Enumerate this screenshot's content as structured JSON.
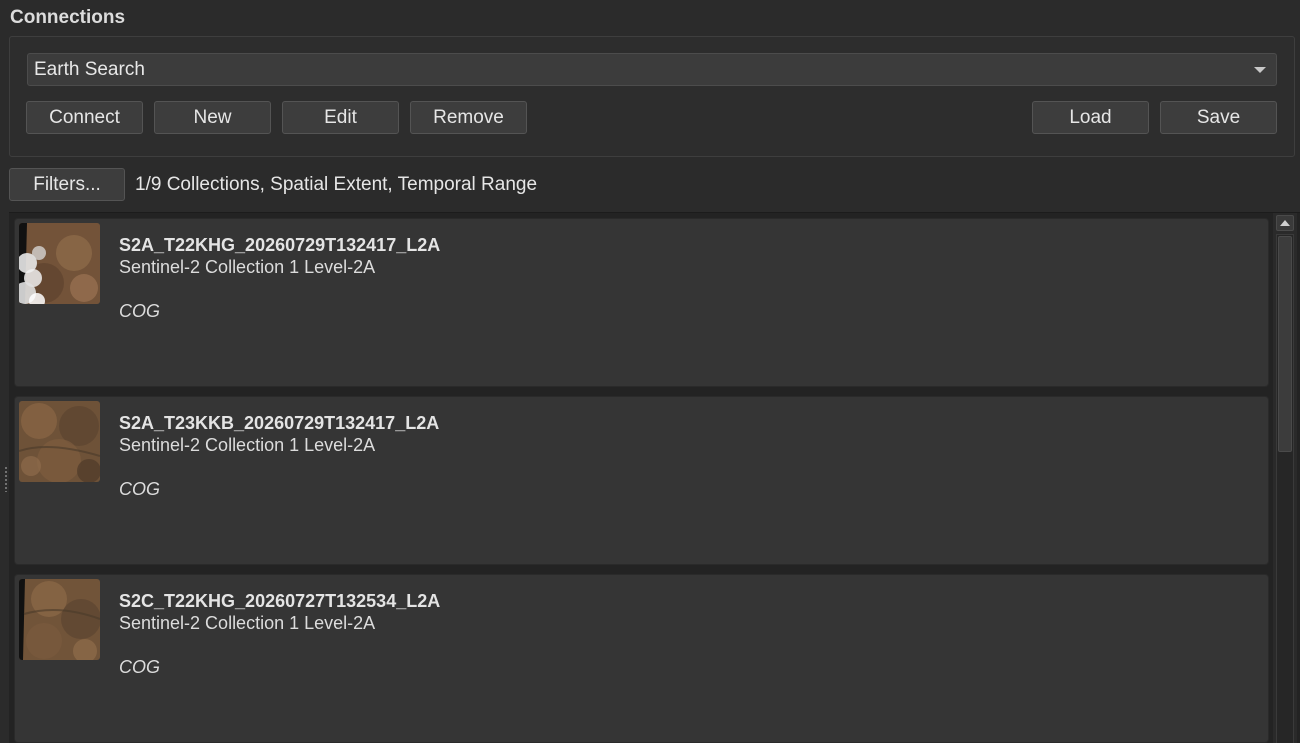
{
  "section_title": "Connections",
  "connection_select": {
    "value": "Earth Search"
  },
  "buttons": {
    "connect": "Connect",
    "new": "New",
    "edit": "Edit",
    "remove": "Remove",
    "load": "Load",
    "save": "Save",
    "filters": "Filters..."
  },
  "filter_summary": "1/9 Collections, Spatial Extent, Temporal Range",
  "items": [
    {
      "title": "S2A_T22KHG_20260729T132417_L2A",
      "collection": "Sentinel-2 Collection 1 Level-2A",
      "format": "COG",
      "thumbnail": "cloudy-satellite-thumbnail"
    },
    {
      "title": "S2A_T23KKB_20260729T132417_L2A",
      "collection": "Sentinel-2 Collection 1 Level-2A",
      "format": "COG",
      "thumbnail": "satellite-thumbnail"
    },
    {
      "title": "S2C_T22KHG_20260727T132534_L2A",
      "collection": "Sentinel-2 Collection 1 Level-2A",
      "format": "COG",
      "thumbnail": "satellite-thumbnail"
    }
  ],
  "colors": {
    "background": "#2b2b2b",
    "card": "#353535",
    "button": "#3d3d3d",
    "text": "#e6e6e6"
  }
}
